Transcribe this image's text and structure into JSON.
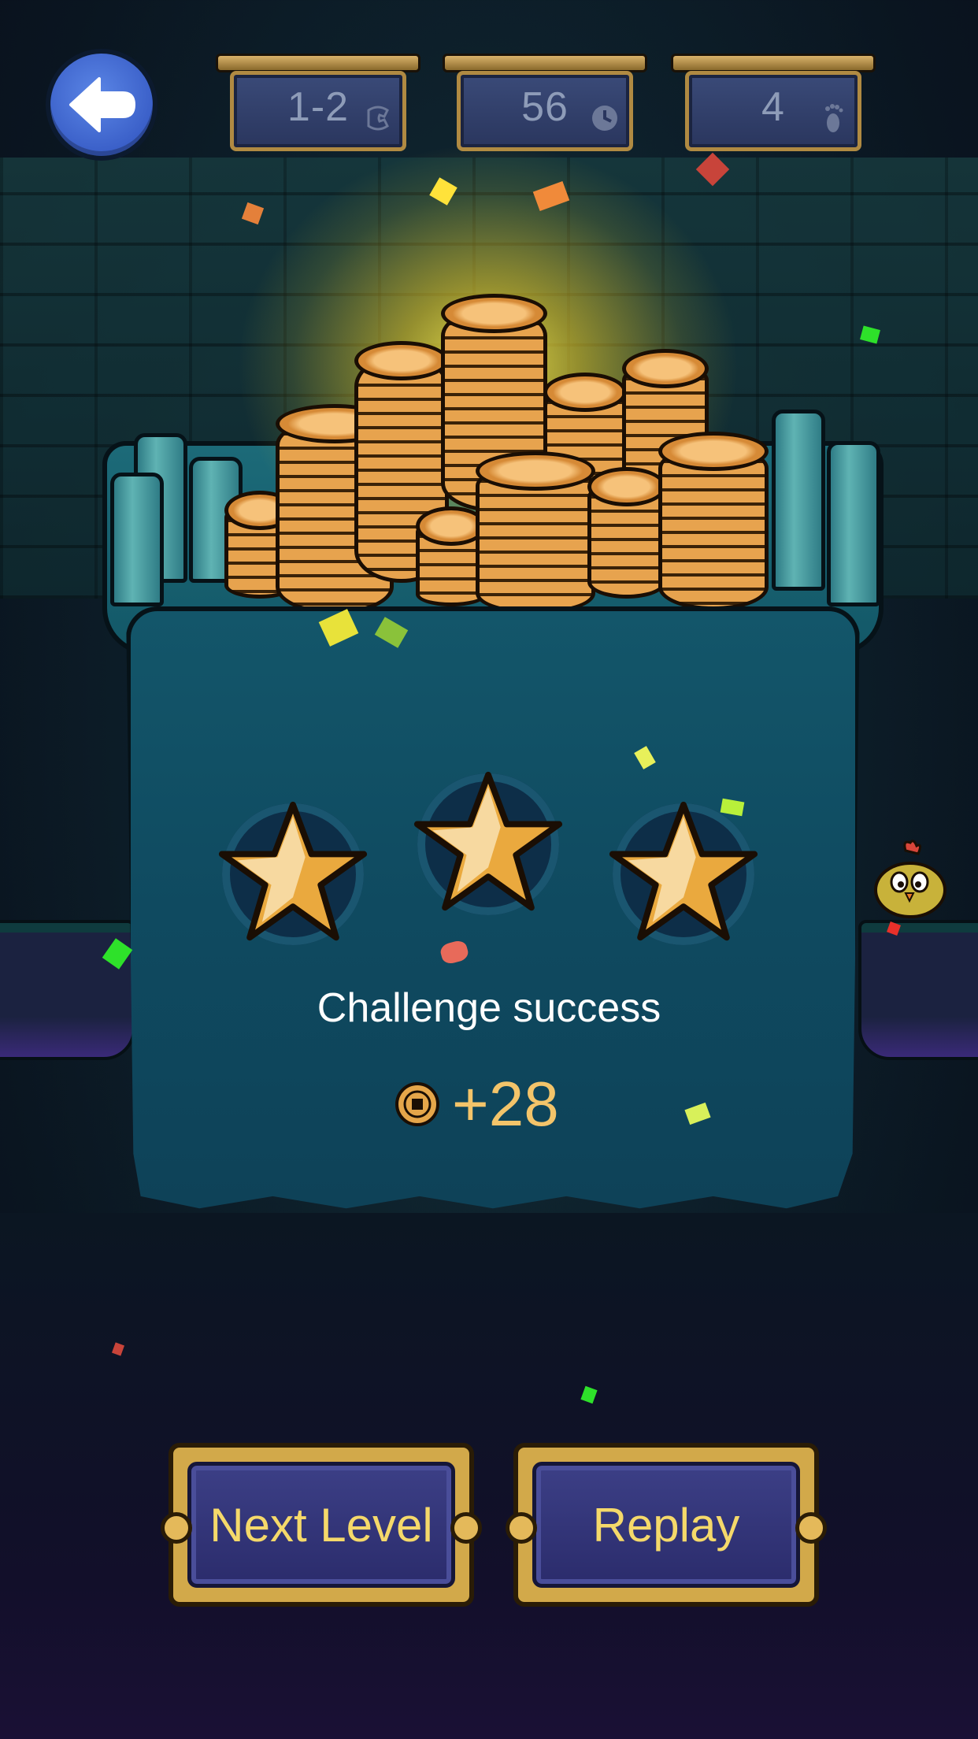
{
  "hud": {
    "back_icon": "back-arrow-icon",
    "level": {
      "value": "1-2",
      "icon": "phone-icon"
    },
    "time": {
      "value": "56",
      "icon": "clock-icon"
    },
    "steps": {
      "value": "4",
      "icon": "footprint-icon"
    }
  },
  "result": {
    "stars_earned": 3,
    "stars_total": 3,
    "message": "Challenge success",
    "reward_icon": "coin-icon",
    "reward_amount": "+28"
  },
  "buttons": {
    "next_label": "Next Level",
    "replay_label": "Replay"
  },
  "colors": {
    "accent_gold": "#f3c46a",
    "button_text": "#f5d96a",
    "panel": "#0f4a60",
    "back_button": "#4a72d8"
  }
}
